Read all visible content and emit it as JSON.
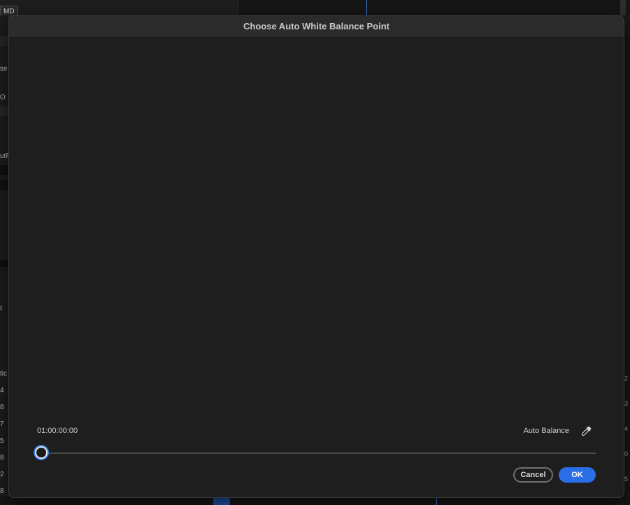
{
  "background": {
    "topbar_chip": "MD",
    "left_fragments": [
      "se",
      "O",
      "utF",
      "I",
      "tic",
      "4",
      "8",
      "7",
      "5",
      "8",
      "2",
      "8"
    ],
    "right_fragments": [
      "2",
      "3",
      "4",
      "0",
      "5"
    ]
  },
  "dialog": {
    "title": "Choose Auto White Balance Point",
    "timecode": "01:00:00:00",
    "auto_balance_label": "Auto Balance",
    "eyedropper_icon": "eyedropper-icon",
    "slider": {
      "position": 0.0
    },
    "buttons": {
      "cancel": "Cancel",
      "ok": "OK"
    },
    "colors": {
      "accent": "#2a6ee5",
      "dialog_bg": "#1e1e1e"
    }
  }
}
